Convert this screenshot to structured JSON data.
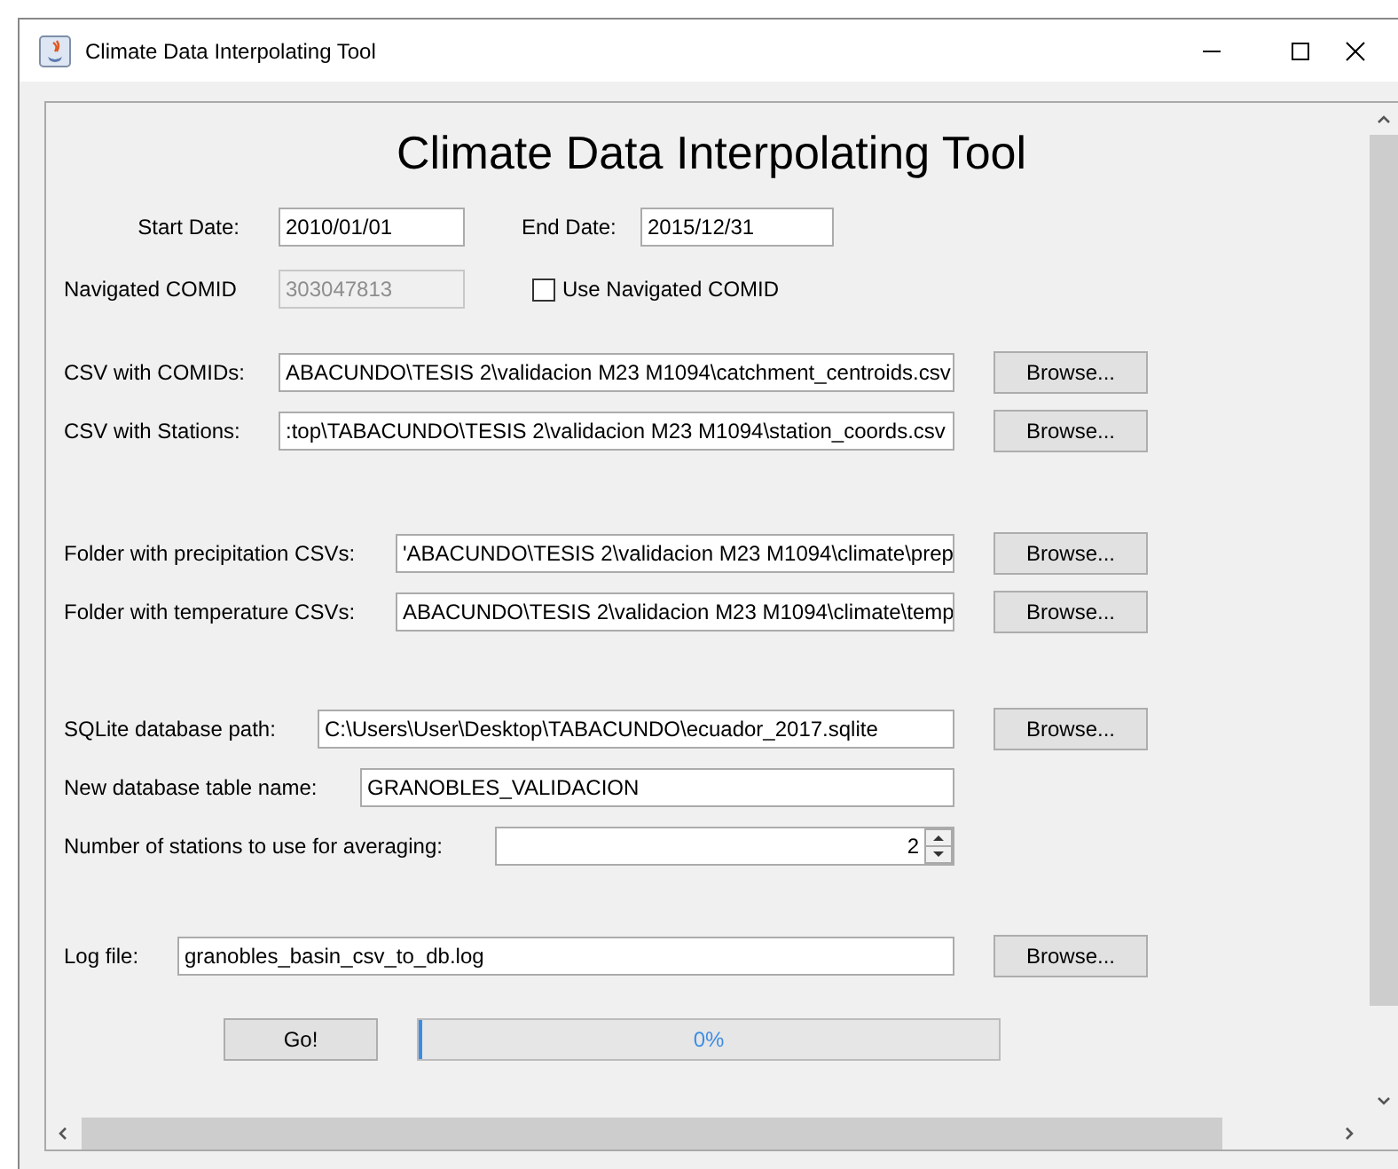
{
  "window": {
    "title": "Climate Data Interpolating Tool"
  },
  "heading": "Climate Data Interpolating Tool",
  "start_date": {
    "label": "Start Date:",
    "value": "2010/01/01"
  },
  "end_date": {
    "label": "End Date:",
    "value": "2015/12/31"
  },
  "navigated_comid": {
    "label": "Navigated COMID",
    "value": "303047813",
    "disabled": true
  },
  "use_navigated": {
    "label": "Use Navigated COMID",
    "checked": false
  },
  "sections": [
    {
      "rows": [
        {
          "kind": "path",
          "label": "CSV with COMIDs:",
          "value": "ABACUNDO\\TESIS 2\\validacion M23 M1094\\catchment_centroids.csv",
          "button": "Browse..."
        },
        {
          "kind": "path",
          "label": "CSV with Stations:",
          "value": ":top\\TABACUNDO\\TESIS 2\\validacion M23 M1094\\station_coords.csv",
          "button": "Browse..."
        }
      ]
    },
    {
      "rows": [
        {
          "kind": "path",
          "label": "Folder with precipitation CSVs:",
          "value": "'ABACUNDO\\TESIS 2\\validacion M23 M1094\\climate\\prep",
          "button": "Browse..."
        },
        {
          "kind": "path",
          "label": "Folder with temperature CSVs:",
          "value": "ABACUNDO\\TESIS 2\\validacion M23 M1094\\climate\\temp",
          "button": "Browse..."
        }
      ]
    },
    {
      "rows": [
        {
          "kind": "path",
          "label": "SQLite database path:",
          "value": "C:\\Users\\User\\Desktop\\TABACUNDO\\ecuador_2017.sqlite",
          "button": "Browse..."
        },
        {
          "kind": "text",
          "label": "New database table name:",
          "value": "GRANOBLES_VALIDACION"
        },
        {
          "kind": "spinner",
          "label": "Number of stations to use for averaging:",
          "value": "2"
        }
      ]
    },
    {
      "rows": [
        {
          "kind": "path",
          "label": "Log file:",
          "value": "granobles_basin_csv_to_db.log",
          "button": "Browse..."
        }
      ]
    }
  ],
  "go_button": "Go!",
  "progress": {
    "level": 0,
    "text": "0%"
  }
}
